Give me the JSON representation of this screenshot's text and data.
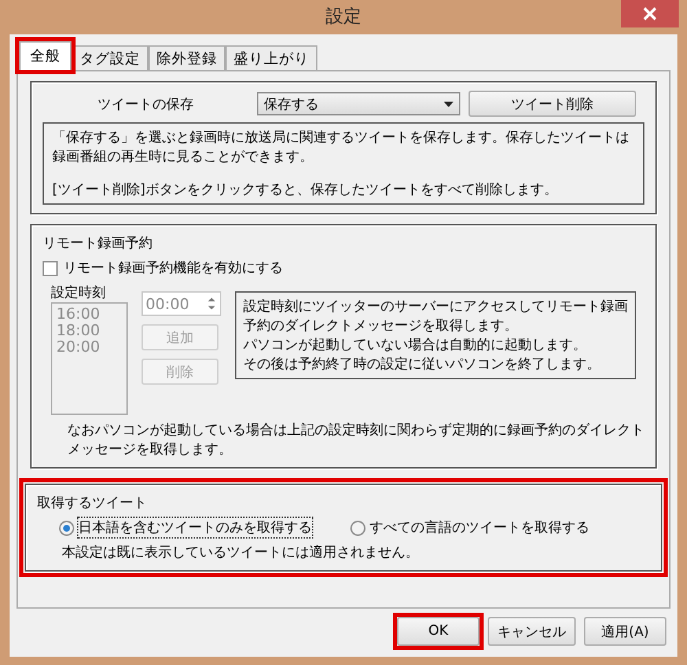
{
  "window": {
    "title": "設定"
  },
  "tabs": [
    {
      "label": "全般",
      "selected": true,
      "highlighted": true
    },
    {
      "label": "タグ設定",
      "selected": false,
      "highlighted": false
    },
    {
      "label": "除外登録",
      "selected": false,
      "highlighted": false
    },
    {
      "label": "盛り上がり",
      "selected": false,
      "highlighted": false
    }
  ],
  "tweet_storage": {
    "label": "ツイートの保存",
    "dropdown": "保存する",
    "delete_button": "ツイート削除",
    "description": [
      "「保存する」を選ぶと録画時に放送局に関連するツイートを保存します。保存したツイートは録画番組の再生時に見ることができます。",
      "[ツイート削除]ボタンをクリックすると、保存したツイートをすべて削除します。"
    ]
  },
  "remote_recording": {
    "title": "リモート録画予約",
    "checkbox": {
      "label": "リモート録画予約機能を有効にする",
      "checked": false
    },
    "times_label": "設定時刻",
    "times": [
      "16:00",
      "18:00",
      "20:00"
    ],
    "times_disabled": true,
    "time_field": {
      "value": "00:00",
      "disabled": true
    },
    "add_button": {
      "label": "追加",
      "disabled": true
    },
    "remove_button": {
      "label": "削除",
      "disabled": true
    },
    "info": [
      "設定時刻にツイッターのサーバーにアクセスしてリモート録画予約のダイレクトメッセージを取得します。",
      "パソコンが起動していない場合は自動的に起動します。",
      "その後は予約終了時の設定に従いパソコンを終了します。"
    ],
    "note": "なおパソコンが起動している場合は上記の設定時刻に関わらず定期的に録画予約のダイレクトメッセージを取得します。"
  },
  "tweet_fetch": {
    "title": "取得するツイート",
    "highlighted": true,
    "options": [
      {
        "label": "日本語を含むツイートのみを取得する",
        "selected": true
      },
      {
        "label": "すべての言語のツイートを取得する",
        "selected": false
      }
    ],
    "note": "本設定は既に表示しているツイートには適用されません。"
  },
  "buttons": [
    {
      "label": "OK",
      "highlighted": true
    },
    {
      "label": "キャンセル",
      "highlighted": false
    },
    {
      "label": "適用(A)",
      "highlighted": false
    }
  ]
}
